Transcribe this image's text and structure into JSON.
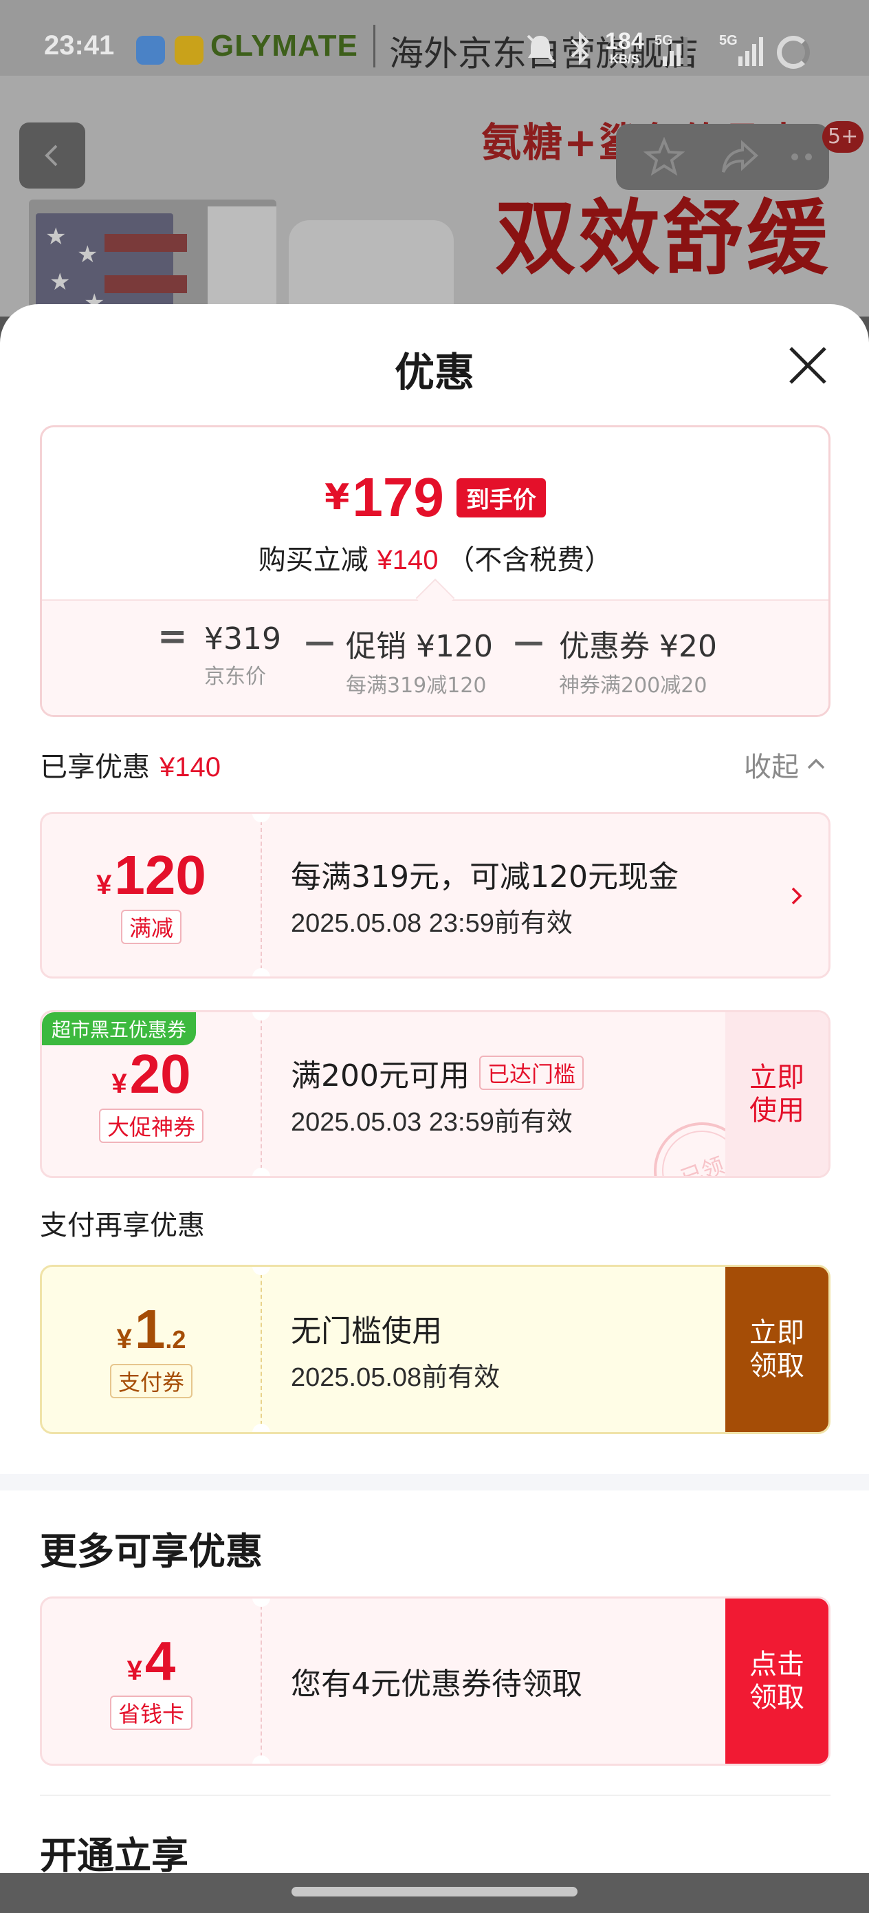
{
  "status_bar": {
    "time": "23:41",
    "net_speed": "184",
    "net_unit": "KB/S",
    "tag1": "5G",
    "tag2": "5G"
  },
  "background_page": {
    "brand_logo": "GLYMATE",
    "store_name": "海外京东自营旗舰店",
    "promo_line1": "氨糖+鲨鱼软骨素",
    "promo_line2": "双效舒缓",
    "cart_badge": "5+"
  },
  "sheet": {
    "title": "优惠"
  },
  "price_summary": {
    "currency": "¥",
    "final_price": "179",
    "final_tag": "到手价",
    "sub_prefix": "购买立减",
    "sub_amount": "¥140",
    "sub_suffix": "（不含税费）",
    "eq": "=",
    "minus": "－",
    "items": [
      {
        "main": "¥319",
        "sub": "京东价"
      },
      {
        "main": "促销 ¥120",
        "sub": "每满319减120"
      },
      {
        "main": "优惠券 ¥20",
        "sub": "神券满200减20"
      }
    ]
  },
  "enjoyed": {
    "label": "已享优惠",
    "amount": "¥140",
    "collapse_label": "收起"
  },
  "coupons": [
    {
      "currency": "¥",
      "amount": "120",
      "label": "满减",
      "title": "每满319元，可减120元现金",
      "date": "2025.05.08 23:59前有效"
    },
    {
      "corner_tag": "超市黑五优惠券",
      "currency": "¥",
      "amount": "20",
      "label": "大促神券",
      "title": "满200元可用",
      "badge": "已达门槛",
      "date": "2025.05.03 23:59前有效",
      "action": "立即使用",
      "stamp": "已领"
    }
  ],
  "payment": {
    "heading": "支付再享优惠",
    "currency": "¥",
    "amount": "1",
    "decimal": ".2",
    "label": "支付券",
    "title": "无门槛使用",
    "date": "2025.05.08前有效",
    "action": "立即领取"
  },
  "more": {
    "heading": "更多可享优惠",
    "currency": "¥",
    "amount": "4",
    "label": "省钱卡",
    "title": "您有4元优惠券待领取",
    "action": "点击领取"
  },
  "open": {
    "heading": "开通立享"
  },
  "colors": {
    "accent_red": "#e4102a",
    "coupon_pink": "#fff4f5",
    "pay_brown": "#a54d06",
    "tag_green": "#3cb93e"
  }
}
